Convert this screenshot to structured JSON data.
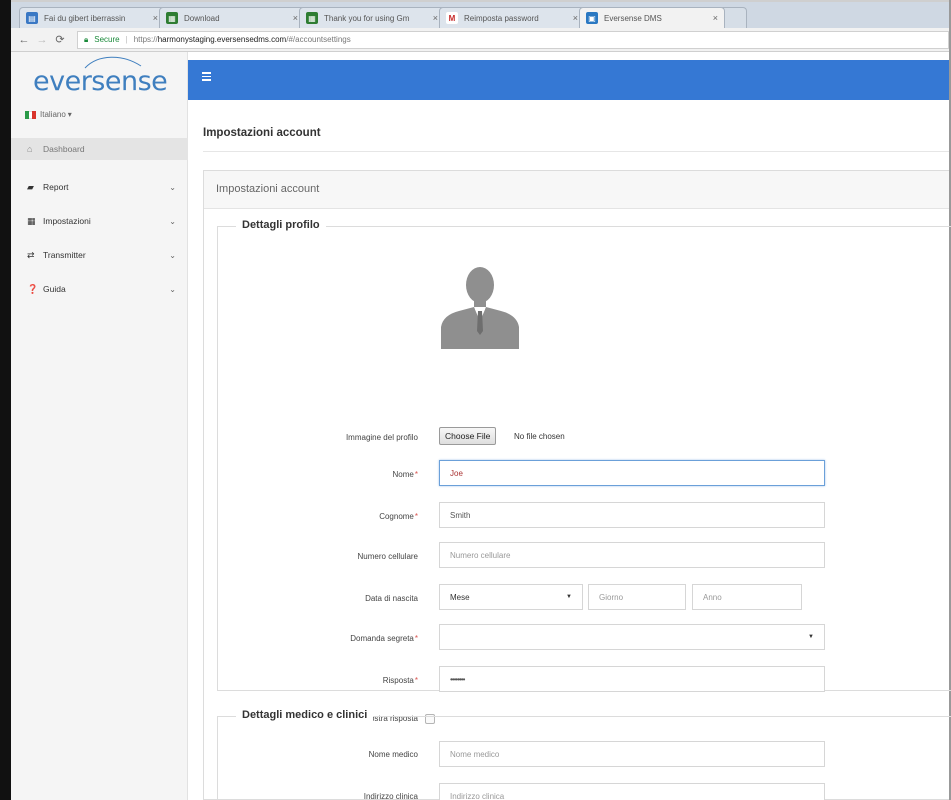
{
  "browser": {
    "tabs": [
      {
        "title": "Fai du gibert iberrassin",
        "icon_color": "#3a78c4",
        "icon_glyph": "▤"
      },
      {
        "title": "Download",
        "icon_color": "#2e7d32",
        "icon_glyph": "▦"
      },
      {
        "title": "Thank you for using Gm",
        "icon_color": "#2e7d32",
        "icon_glyph": "▦"
      },
      {
        "title": "Reimposta password",
        "icon_color": "#ffffff",
        "icon_glyph": "M"
      },
      {
        "title": "Eversense DMS",
        "icon_color": "#2a78c2",
        "icon_glyph": "▣"
      }
    ],
    "close_glyph": "×",
    "secure_label": "Secure",
    "url_prefix": "https://",
    "url_domain": "harmonystaging.eversensedms.com",
    "url_path": "/#/accountsettings"
  },
  "sidebar": {
    "logo_text": "eversense",
    "language": "Italiano",
    "language_caret": "▾",
    "items": [
      {
        "label": "Dashboard",
        "icon": "dashboard-icon",
        "glyph": "⌂",
        "active": true,
        "chevron": ""
      },
      {
        "label": "Report",
        "icon": "book-icon",
        "glyph": "▰",
        "active": false,
        "chevron": "⌄"
      },
      {
        "label": "Impostazioni",
        "icon": "table-icon",
        "glyph": "▦",
        "active": false,
        "chevron": "⌄"
      },
      {
        "label": "Transmitter",
        "icon": "transmitter-icon",
        "glyph": "⇄",
        "active": false,
        "chevron": "⌄"
      },
      {
        "label": "Guida",
        "icon": "help-icon",
        "glyph": "❓",
        "active": false,
        "chevron": "⌄"
      }
    ]
  },
  "header": {
    "bar_color": "#3578d4"
  },
  "page": {
    "title": "Impostazioni account",
    "panel_title": "Impostazioni account"
  },
  "profile": {
    "legend": "Dettagli profilo",
    "image_label": "Immagine del profilo",
    "file_button": "Choose File",
    "file_status": "No file chosen",
    "nome_label": "Nome",
    "nome_value": "Joe",
    "cognome_label": "Cognome",
    "cognome_value": "Smith",
    "cellulare_label": "Numero cellulare",
    "cellulare_placeholder": "Numero cellulare",
    "nascita_label": "Data di nascita",
    "mese_value": "Mese",
    "giorno_placeholder": "Giorno",
    "anno_placeholder": "Anno",
    "domanda_label": "Domanda segreta",
    "domanda_value": "",
    "risposta_label": "Risposta",
    "risposta_value": "••••••••",
    "mostra_label": "Mostra risposta",
    "required_mark": "*"
  },
  "medical": {
    "legend": "Dettagli medico e clinici",
    "medico_label": "Nome medico",
    "medico_placeholder": "Nome medico",
    "clinica_label": "Indirizzo clinica",
    "clinica_placeholder": "Indirizzo clinica"
  }
}
